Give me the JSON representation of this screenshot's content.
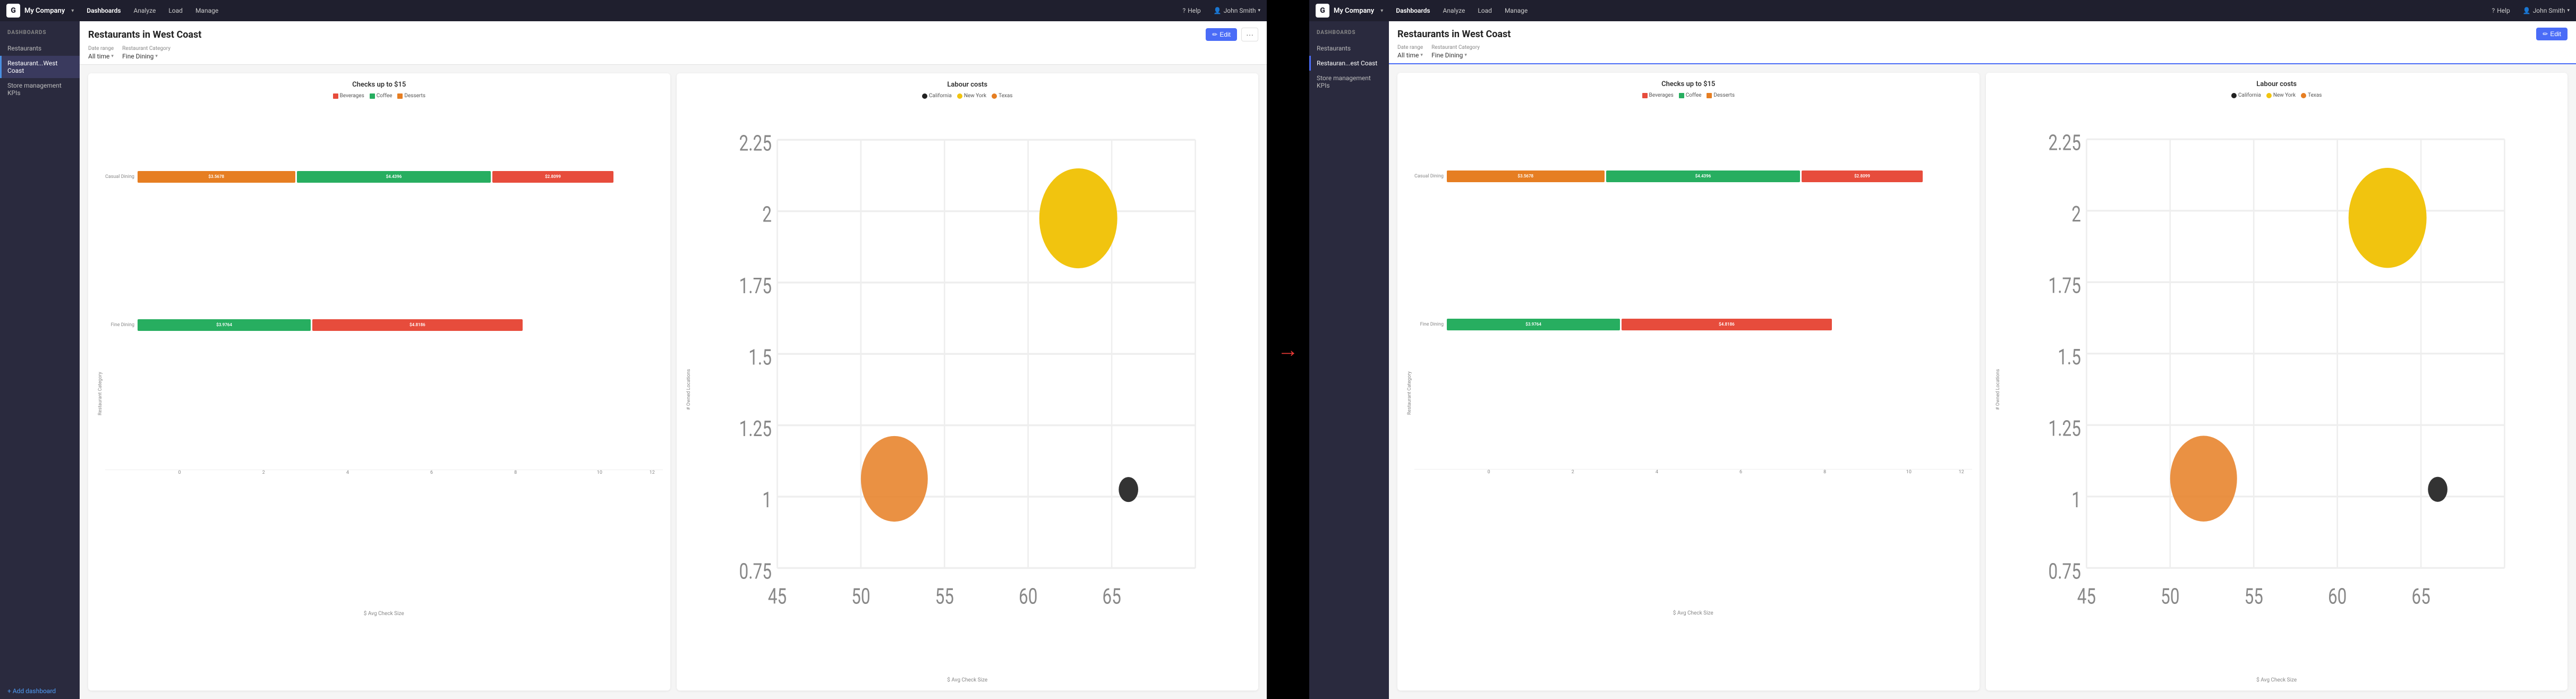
{
  "left_panel": {
    "topnav": {
      "logo": "G",
      "company": "My Company",
      "nav_items": [
        "Dashboards",
        "Analyze",
        "Load",
        "Manage"
      ],
      "active_nav": "Dashboards",
      "help": "Help",
      "user": "John Smith"
    },
    "sidebar": {
      "section_title": "DASHBOARDS",
      "items": [
        "Restaurants",
        "Restaurant...West Coast",
        "Store management KPIs"
      ],
      "active_item": "Restaurant...West Coast",
      "add_label": "+ Add dashboard"
    },
    "header": {
      "title": "Restaurants in West Coast",
      "edit_label": "Edit",
      "more_label": "···",
      "filter1_label": "Date range",
      "filter1_value": "All time",
      "filter2_label": "Restaurant Category",
      "filter2_value": "Fine Dining"
    },
    "chart1": {
      "title": "Checks up to $15",
      "legend": [
        {
          "label": "Beverages",
          "color": "#e74c3c"
        },
        {
          "label": "Coffee",
          "color": "#27ae60"
        },
        {
          "label": "Desserts",
          "color": "#e67e22"
        }
      ],
      "y_label": "Restaurant Category",
      "x_title": "$ Avg Check Size",
      "x_ticks": [
        "0",
        "2",
        "4",
        "6",
        "8",
        "10",
        "12"
      ],
      "rows": [
        {
          "label": "Casual Dining",
          "bars": [
            {
              "value": "$3.5678",
              "color": "#e67e22",
              "width_pct": 30
            },
            {
              "value": "$4.4396",
              "color": "#27ae60",
              "width_pct": 37
            },
            {
              "value": "$2.8099",
              "color": "#e74c3c",
              "width_pct": 23
            }
          ]
        },
        {
          "label": "Fine Dining",
          "bars": [
            {
              "value": "$3.9764",
              "color": "#27ae60",
              "width_pct": 33
            },
            {
              "value": "$4.8186",
              "color": "#e74c3c",
              "width_pct": 40
            }
          ]
        }
      ]
    },
    "chart2": {
      "title": "Labour costs",
      "legend": [
        {
          "label": "California",
          "color": "#222"
        },
        {
          "label": "New York",
          "color": "#f1c40f"
        },
        {
          "label": "Texas",
          "color": "#e67e22"
        }
      ],
      "y_label": "# Owned Locations",
      "x_title": "$ Avg Check Size",
      "x_ticks": [
        "45",
        "50",
        "55",
        "60",
        "65"
      ],
      "y_ticks": [
        "0.75",
        "1",
        "1.25",
        "1.5",
        "1.75",
        "2",
        "2.25"
      ],
      "bubbles": [
        {
          "cx_pct": 62,
          "cy_pct": 22,
          "r": 22,
          "color": "#f1c40f",
          "opacity": 1
        },
        {
          "cx_pct": 28,
          "cy_pct": 78,
          "r": 18,
          "color": "#e67e22",
          "opacity": 0.8
        },
        {
          "cx_pct": 82,
          "cy_pct": 80,
          "r": 5,
          "color": "#222",
          "opacity": 1
        }
      ]
    }
  },
  "right_panel": {
    "topnav": {
      "logo": "G",
      "company": "My Company",
      "nav_items": [
        "Dashboards",
        "Analyze",
        "Load",
        "Manage"
      ],
      "active_nav": "Dashboards",
      "help": "Help",
      "user": "John Smith"
    },
    "sidebar": {
      "section_title": "DASHBOARDS",
      "items": [
        "Restaurants",
        "Restauran...est Coast",
        "Store management KPIs"
      ],
      "active_item": "Restauran...est Coast",
      "add_label": "+ Add dashboard"
    },
    "header": {
      "title": "Restaurants in West Coast",
      "edit_label": "Edit",
      "filter1_label": "Date range",
      "filter1_value": "All time",
      "filter2_label": "Restaurant Category",
      "filter2_value": "Fine Dining"
    },
    "chart1": {
      "title": "Checks up to $15",
      "legend": [
        {
          "label": "Beverages",
          "color": "#e74c3c"
        },
        {
          "label": "Coffee",
          "color": "#27ae60"
        },
        {
          "label": "Desserts",
          "color": "#e67e22"
        }
      ],
      "y_label": "Restaurant Category",
      "x_title": "$ Avg Check Size"
    },
    "chart2": {
      "title": "Labour costs",
      "legend": [
        {
          "label": "California",
          "color": "#222"
        },
        {
          "label": "New York",
          "color": "#f1c40f"
        },
        {
          "label": "Texas",
          "color": "#e67e22"
        }
      ],
      "y_label": "# Owned Locations",
      "x_title": "$ Avg Check Size"
    }
  }
}
